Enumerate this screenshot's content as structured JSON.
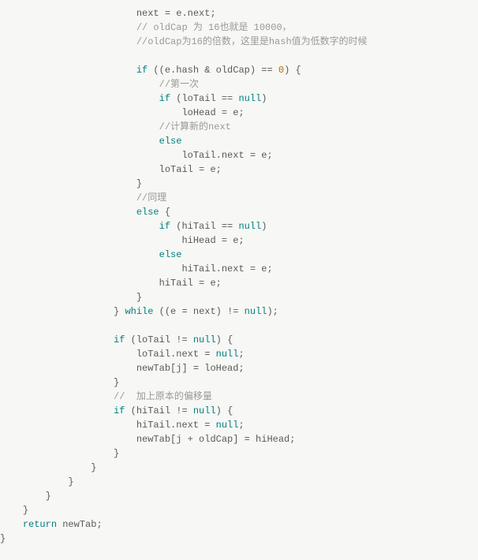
{
  "code": {
    "l01_a": "next = e.next;",
    "l02_a": "// oldCap 为 16也就是 10000，",
    "l03_a": "//oldCap为16的倍数，这里是hash值为低数字的时候",
    "l05_a": "if",
    "l05_b": " ((e.hash & oldCap) == ",
    "l05_c": "0",
    "l05_d": ") {",
    "l06_a": "//第一次",
    "l07_a": "if",
    "l07_b": " (loTail == ",
    "l07_c": "null",
    "l07_d": ")",
    "l08_a": "loHead = e;",
    "l09_a": "//计算新的next",
    "l10_a": "else",
    "l11_a": "loTail.next = e;",
    "l12_a": "loTail = e;",
    "l13_a": "}",
    "l14_a": "//同理",
    "l15_a": "else",
    "l15_b": " {",
    "l16_a": "if",
    "l16_b": " (hiTail == ",
    "l16_c": "null",
    "l16_d": ")",
    "l17_a": "hiHead = e;",
    "l18_a": "else",
    "l19_a": "hiTail.next = e;",
    "l20_a": "hiTail = e;",
    "l21_a": "}",
    "l22_a": "} ",
    "l22_b": "while",
    "l22_c": " ((e = next) != ",
    "l22_d": "null",
    "l22_e": ");",
    "l24_a": "if",
    "l24_b": " (loTail != ",
    "l24_c": "null",
    "l24_d": ") {",
    "l25_a": "loTail.next = ",
    "l25_b": "null",
    "l25_c": ";",
    "l26_a": "newTab[j] = loHead;",
    "l27_a": "}",
    "l28_a": "//  加上原本的偏移量",
    "l29_a": "if",
    "l29_b": " (hiTail != ",
    "l29_c": "null",
    "l29_d": ") {",
    "l30_a": "hiTail.next = ",
    "l30_b": "null",
    "l30_c": ";",
    "l31_a": "newTab[j + oldCap] = hiHead;",
    "l32_a": "}",
    "l33_a": "}",
    "l34_a": "}",
    "l35_a": "}",
    "l36_a": "}",
    "l37_a": "return",
    "l37_b": " newTab;",
    "l38_a": "}"
  }
}
